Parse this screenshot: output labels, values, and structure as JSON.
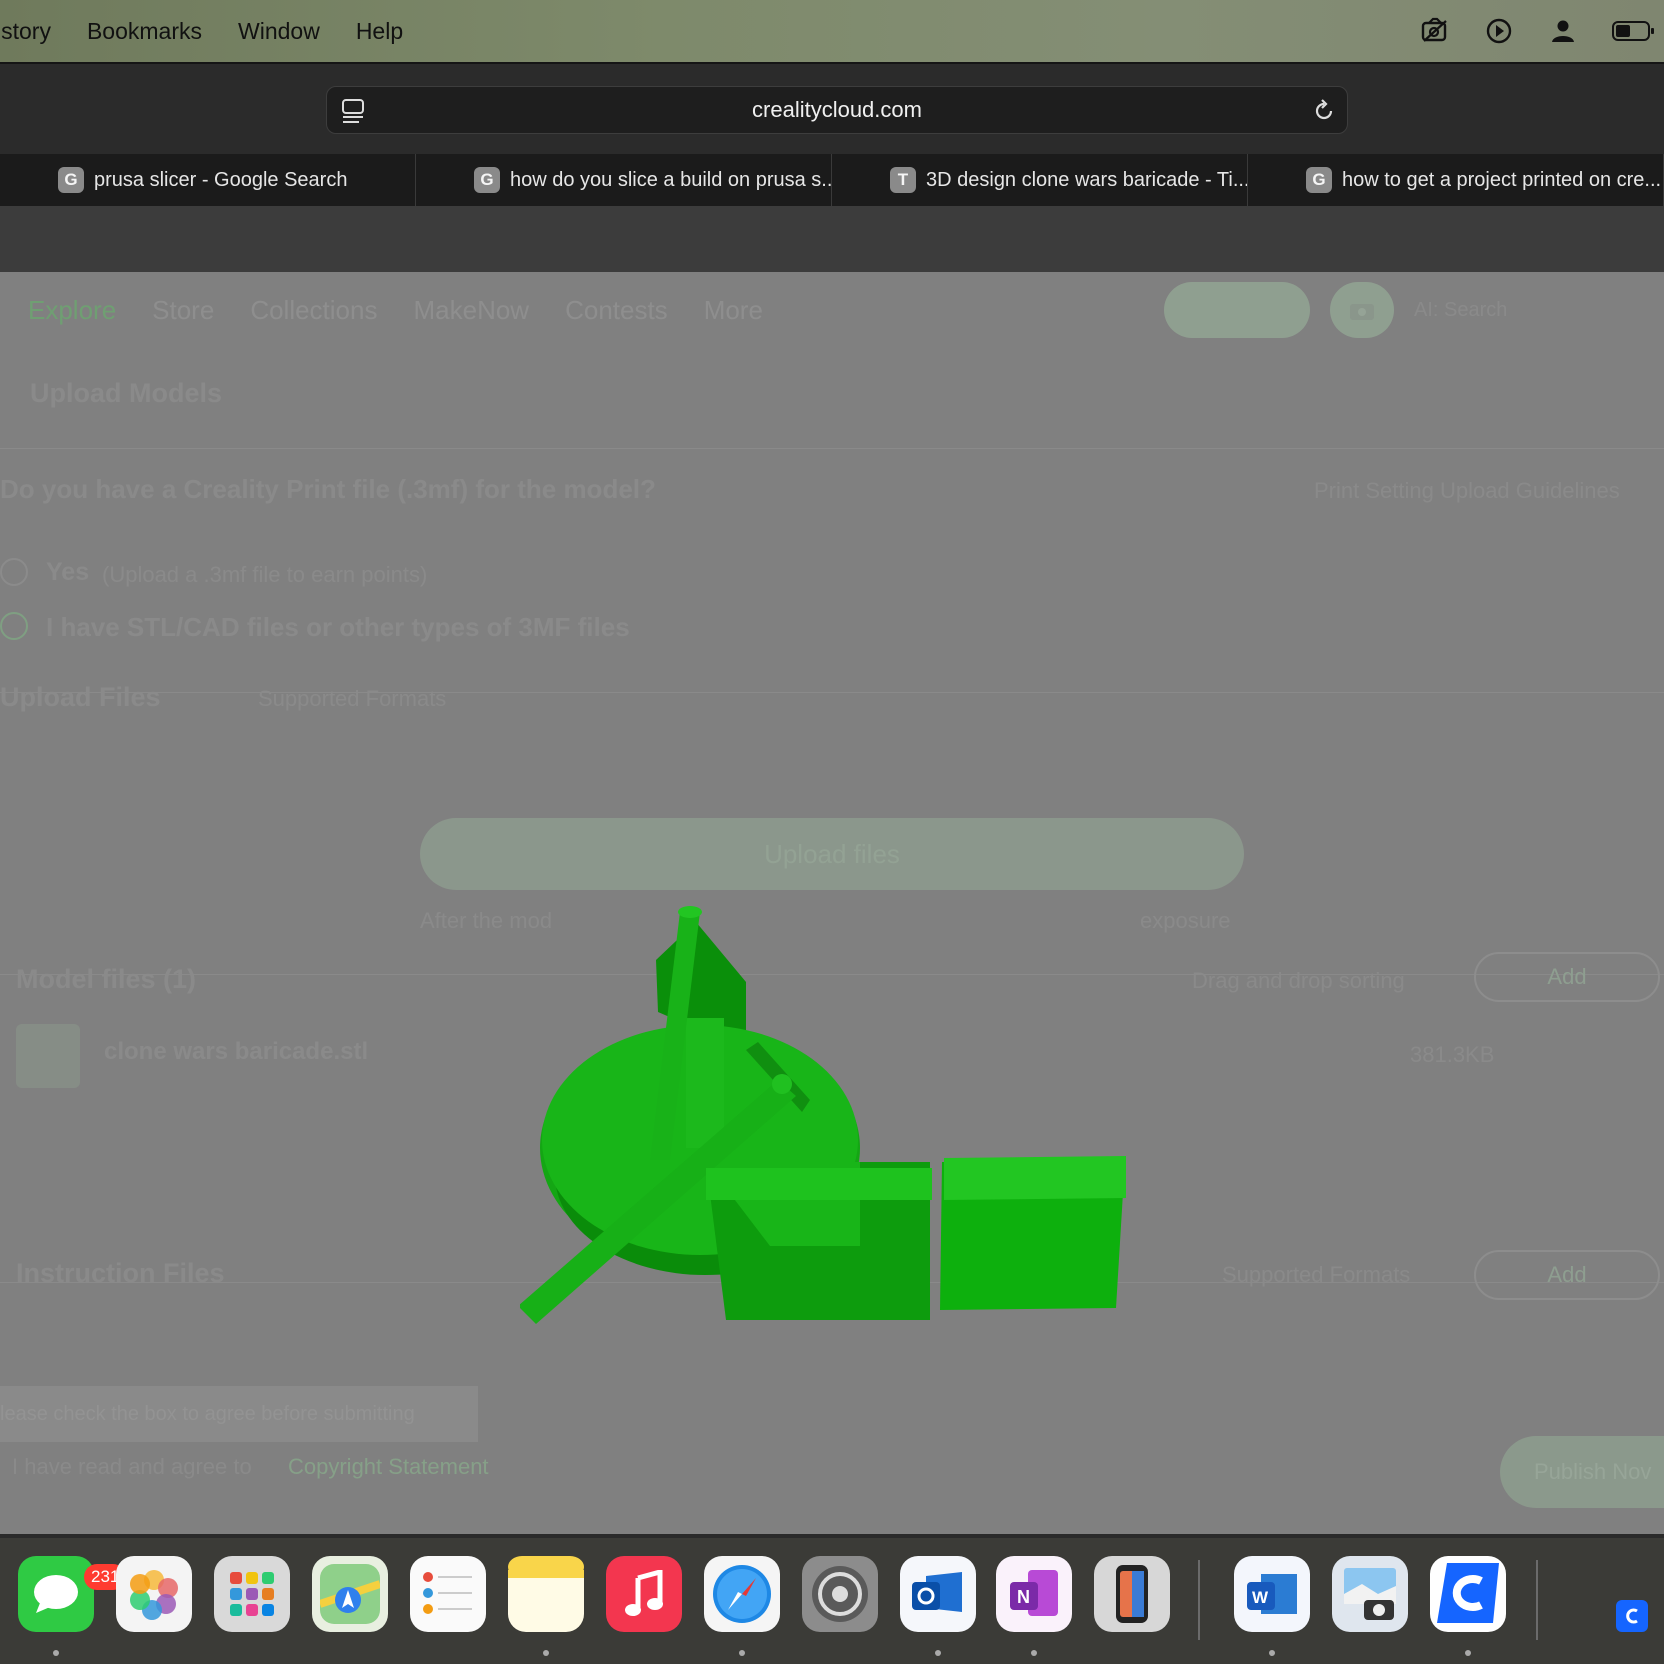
{
  "menubar": {
    "items": [
      "istory",
      "Bookmarks",
      "Window",
      "Help"
    ]
  },
  "browser": {
    "url": "crealitycloud.com",
    "tabs": [
      {
        "favicon": "G",
        "title": "prusa slicer - Google Search"
      },
      {
        "favicon": "G",
        "title": "how do you slice a build on prusa s..."
      },
      {
        "favicon": "T",
        "title": "3D design clone wars baricade - Ti..."
      },
      {
        "favicon": "G",
        "title": "how to get a project printed on cre..."
      }
    ]
  },
  "page": {
    "nav": [
      "Explore",
      "Store",
      "Collections",
      "MakeNow",
      "Contests",
      "More"
    ],
    "search_placeholder": "AI: Search",
    "upload_models": "Upload Models",
    "question": "Do you have a Creality Print file (.3mf) for the model?",
    "guidelines_link": "Print Setting Upload Guidelines",
    "option_yes": "Yes",
    "option_yes_hint": "(Upload a .3mf file to earn points)",
    "option_stl": "I have STL/CAD files or other types of 3MF files",
    "upload_files": "Upload Files",
    "supported_formats": "Supported Formats",
    "upload_button": "Upload files",
    "after_upload_note": "After the mod",
    "after_upload_note_tail": "exposure",
    "model_files": "Model files (1)",
    "drag_sort": "Drag and drop sorting",
    "add_label": "Add",
    "file_name": "clone wars baricade.stl",
    "file_size": "381.3KB",
    "instruction_files": "Instruction Files",
    "instruction_formats": "Supported Formats",
    "agree_notice": "lease check the box to agree before submitting",
    "agree_text": "I have read and agree to",
    "copyright_link": "Copyright Statement",
    "publish_label": "Publish Nov"
  },
  "dock": {
    "messages_badge": "231",
    "apps": [
      "messages-icon",
      "photos-icon",
      "launchpad-icon",
      "maps-icon",
      "reminders-icon",
      "notes-icon",
      "music-icon",
      "safari-icon",
      "system-settings-icon",
      "outlook-icon",
      "onenote-icon",
      "iphone-mirroring-icon",
      "word-icon",
      "preview-icon",
      "creality-icon"
    ]
  },
  "colors": {
    "model_green": "#16b416",
    "accent_green": "#1ea51e"
  }
}
